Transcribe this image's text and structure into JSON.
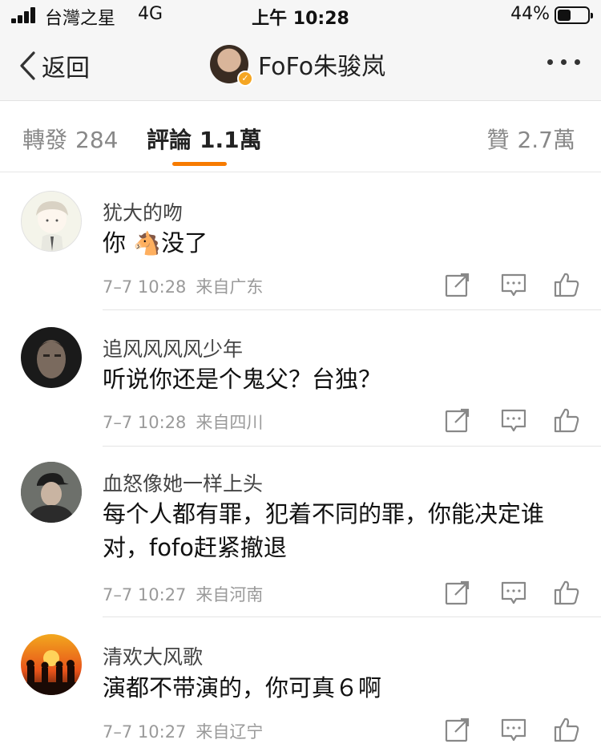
{
  "status_bar": {
    "carrier": "台灣之星",
    "network": "4G",
    "time": "上午 10:28",
    "battery": "44%",
    "battery_level": 0.44
  },
  "nav": {
    "back_label": "返回",
    "title": "FoFo朱骏岚"
  },
  "tabs": {
    "repost": {
      "label": "轉發",
      "count": "284"
    },
    "comments": {
      "label": "評論",
      "count": "1.1萬"
    },
    "likes": {
      "label": "贊",
      "count": "2.7萬"
    }
  },
  "colors": {
    "accent": "#f77b00",
    "verify_badge": "#f5a623"
  },
  "comments": [
    {
      "name": "犹大的吻",
      "text_before": "你 ",
      "emoji": "🐴",
      "text_after": "没了",
      "time": "7–7 10:28",
      "location": "来自广东",
      "avatar": "anime-boy-avatar"
    },
    {
      "name": "追风风风风少年",
      "text": "听说你还是个鬼父？台独？",
      "time": "7–7 10:28",
      "location": "来自四川",
      "avatar": "dark-face-avatar"
    },
    {
      "name": "血怒像她一样上头",
      "text": "每个人都有罪，犯着不同的罪，你能决定谁对，fofo赶紧撤退",
      "time": "7–7 10:27",
      "location": "来自河南",
      "avatar": "cap-man-avatar"
    },
    {
      "name": "清欢大风歌",
      "text": "演都不带演的，你可真６啊",
      "time": "7–7 10:27",
      "location": "来自辽宁",
      "avatar": "sunset-silhouette-avatar"
    }
  ]
}
